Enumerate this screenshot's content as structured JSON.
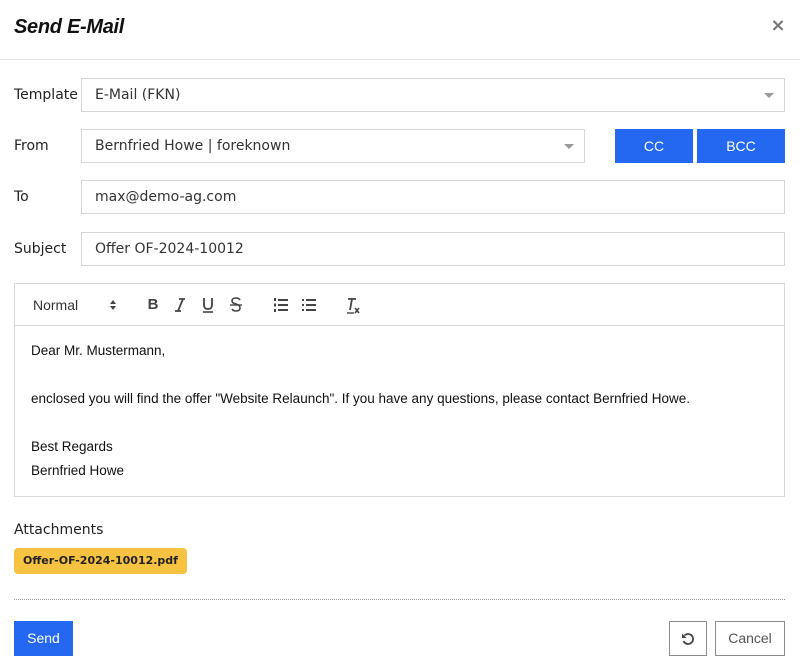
{
  "dialog": {
    "title": "Send E-Mail",
    "close_icon": "×"
  },
  "form": {
    "template": {
      "label": "Template",
      "value": "E-Mail (FKN)"
    },
    "from": {
      "label": "From",
      "value": "Bernfried Howe | foreknown"
    },
    "to": {
      "label": "To",
      "value": "max@demo-ag.com"
    },
    "subject": {
      "label": "Subject",
      "value": "Offer OF-2024-10012"
    },
    "cc_label": "CC",
    "bcc_label": "BCC"
  },
  "editor": {
    "toolbar": {
      "format": "Normal",
      "format_arrows": "⬍",
      "bold": "B",
      "italic": "I",
      "underline": "U",
      "strike": "S",
      "ordered_list_icon": "ordered-list",
      "bullet_list_icon": "bullet-list",
      "clear_format_icon": "clear-format"
    },
    "lines": [
      "Dear Mr. Mustermann,",
      "",
      "enclosed you will find the offer \"Website Relaunch\". If you have any questions, please contact Bernfried Howe.",
      "",
      "Best Regards",
      "Bernfried Howe"
    ]
  },
  "attachments": {
    "label": "Attachments",
    "files": [
      "Offer-OF-2024-10012.pdf"
    ]
  },
  "footer": {
    "send_label": "Send",
    "reset_icon": "undo",
    "cancel_label": "Cancel"
  },
  "colors": {
    "primary": "#2468f2",
    "attachment_chip": "#f5c242"
  }
}
